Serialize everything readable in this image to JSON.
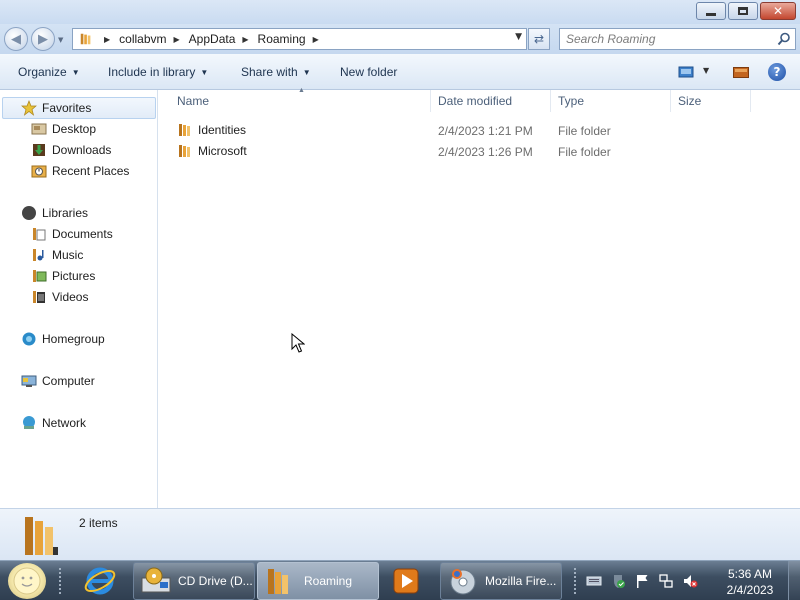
{
  "window": {
    "minimize_icon": "minimize-icon",
    "maximize_icon": "restore-icon",
    "close_icon": "close-icon",
    "close_glyph": "✕"
  },
  "address": {
    "breadcrumb": [
      "collabvm",
      "AppData",
      "Roaming"
    ],
    "search_placeholder": "Search Roaming"
  },
  "toolbar": {
    "organize": "Organize",
    "include_in_library": "Include in library",
    "share_with": "Share with",
    "new_folder": "New folder"
  },
  "nav": {
    "favorites": "Favorites",
    "favorites_items": [
      "Desktop",
      "Downloads",
      "Recent Places"
    ],
    "libraries": "Libraries",
    "libraries_items": [
      "Documents",
      "Music",
      "Pictures",
      "Videos"
    ],
    "homegroup": "Homegroup",
    "computer": "Computer",
    "network": "Network"
  },
  "columns": {
    "name": "Name",
    "date_modified": "Date modified",
    "type": "Type",
    "size": "Size"
  },
  "files": [
    {
      "name": "Identities",
      "date": "2/4/2023 1:21 PM",
      "type": "File folder"
    },
    {
      "name": "Microsoft",
      "date": "2/4/2023 1:26 PM",
      "type": "File folder"
    }
  ],
  "details": {
    "item_count": "2 items"
  },
  "taskbar": {
    "buttons": [
      {
        "label": "CD Drive (D..."
      },
      {
        "label": "Roaming"
      },
      {
        "label": "Mozilla Fire..."
      }
    ],
    "clock_time": "5:36 AM",
    "clock_date": "2/4/2023"
  },
  "colors": {
    "accent": "#1d4fa6",
    "folder": "#e8a33a"
  }
}
